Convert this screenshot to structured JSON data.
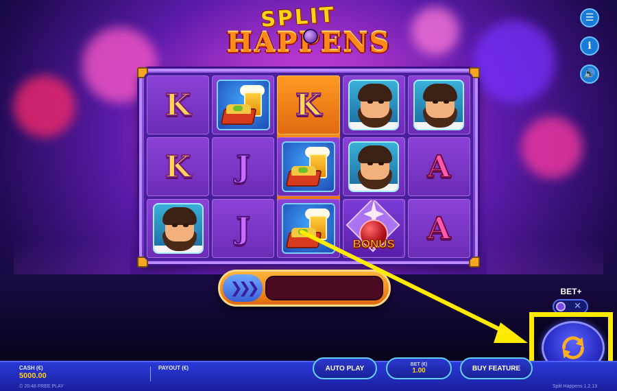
{
  "game": {
    "logo_top": "SPLIT",
    "logo_bottom": "HAPPENS"
  },
  "reels": [
    [
      "K",
      "K",
      "bowler"
    ],
    [
      "beer-nachos",
      "J",
      "J"
    ],
    [
      "K",
      "beer-nachos",
      "beer-nachos"
    ],
    [
      "bowler",
      "bowler",
      "bonus"
    ],
    [
      "bowler",
      "A",
      "A"
    ]
  ],
  "symbols": {
    "bonus_label": "BONUS"
  },
  "controls": {
    "betplus_label": "BET+",
    "betplus_x": "✕",
    "auto_play": "AUTO PLAY",
    "bet_label": "BET (€)",
    "bet_value": "1.00",
    "buy_feature": "BUY FEATURE"
  },
  "bottom_bar": {
    "cash_label": "CASH (€)",
    "cash_value": "5000.00",
    "payout_label": "PAYOUT (€)",
    "time_mode": "20:48 FREE PLAY",
    "version": "Split Happens 1.2.13"
  },
  "side_menu": {
    "menu_icon": "menu-icon",
    "info_icon": "info-icon",
    "sound_icon": "sound-icon"
  },
  "colors": {
    "accent_yellow": "#ffeb00",
    "bar_blue": "#2a3ad8",
    "frame_purple": "#9b5ce8",
    "highlight_orange": "#ff9a22"
  }
}
